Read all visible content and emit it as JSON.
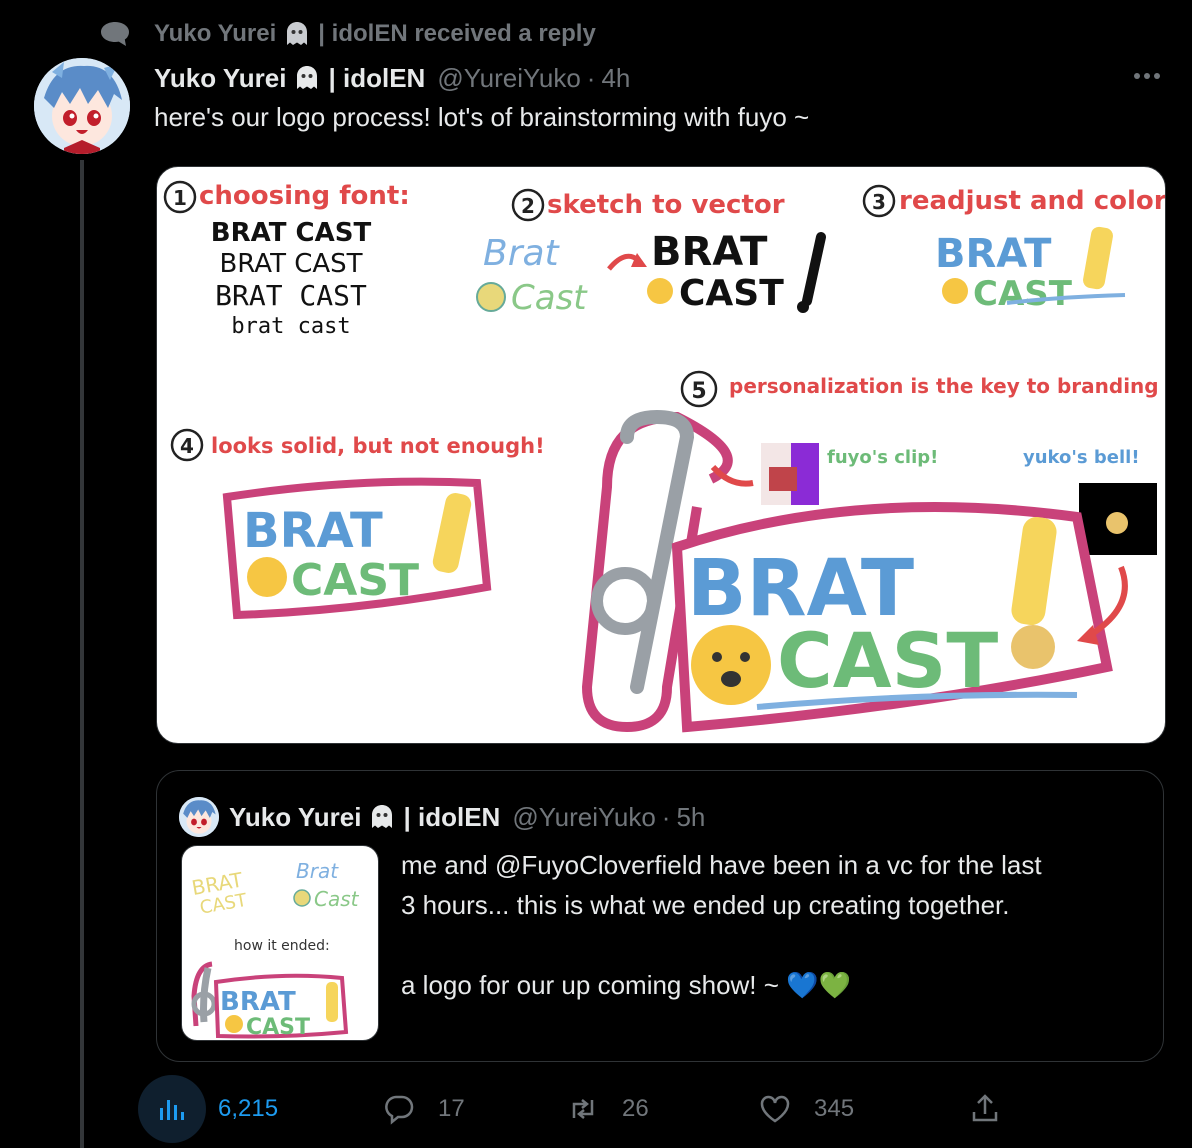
{
  "social_context": {
    "name": "Yuko Yurei",
    "suffix": "| idolEN received a reply",
    "icon": "speech-bubble-icon"
  },
  "tweet": {
    "name_part1": "Yuko Yurei",
    "name_part2": "| idolEN",
    "handle": "@YureiYuko",
    "dot": "·",
    "time": "4h",
    "text": "here's our logo process! lot's of brainstorming with fuyo ~",
    "media": {
      "step1": "choosing font:",
      "step1_fonts": [
        "BRAT CAST",
        "BRAT CAST",
        "BRAT CAST",
        "brat cast"
      ],
      "step2": "sketch to vector",
      "step3": "readjust and color",
      "step4": "looks solid, but not enough!",
      "step5": "personalization is the key to branding",
      "clip_label": "fuyo's clip!",
      "bell_label": "yuko's bell!",
      "logo_word1": "BRAT",
      "logo_word2": "CAST",
      "sketch_word1": "Brat",
      "sketch_word2": "Cast",
      "num1": "1",
      "num2": "2",
      "num3": "3",
      "num4": "4",
      "num5": "5"
    }
  },
  "quote": {
    "name_part1": "Yuko Yurei",
    "name_part2": "| idolEN",
    "handle": "@YureiYuko",
    "dot": "·",
    "time": "5h",
    "line1": "me and @FuyoCloverfield have been in a vc for the last",
    "line2": "3 hours... this is what we ended up creating together.",
    "line3": "a logo for our up coming show! ~ 💙💚",
    "thumb_caption": "how it ended:"
  },
  "actions": {
    "views": "6,215",
    "replies": "17",
    "retweets": "26",
    "likes": "345"
  },
  "colors": {
    "bg": "#000000",
    "text": "#e7e9ea",
    "muted": "#71767b",
    "accent": "#1d9bf0",
    "logo_blue": "#5b9bd5",
    "logo_green": "#6dbb78",
    "logo_pink": "#c9427a",
    "step_red": "#e0494a"
  }
}
